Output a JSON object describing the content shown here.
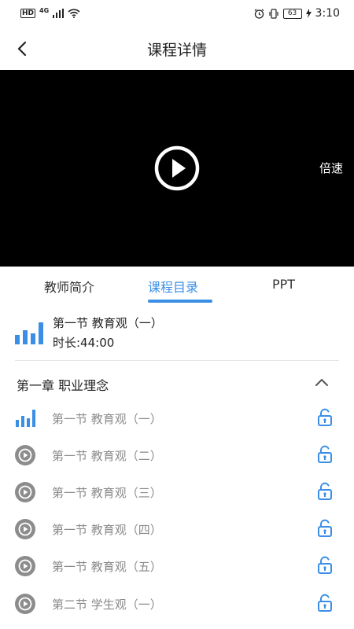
{
  "status_bar": {
    "hd": "HD",
    "network": "4G",
    "battery": "63",
    "time": "3:10"
  },
  "header": {
    "title": "课程详情",
    "back_icon": "chevron-left-icon"
  },
  "video": {
    "play_icon": "play-circle-icon",
    "speed_label": "倍速",
    "background": "#000000"
  },
  "tabs": [
    {
      "label": "教师简介",
      "active": false
    },
    {
      "label": "课程目录",
      "active": true
    },
    {
      "label": "PPT",
      "active": false
    }
  ],
  "now_playing": {
    "icon": "audio-bars-icon",
    "title": "第一节 教育观（一）",
    "duration": "时长:44:00"
  },
  "chapter": {
    "title": "第一章 职业理念",
    "expanded": true,
    "toggle_icon": "chevron-up-icon"
  },
  "lessons": [
    {
      "label": "第一节 教育观（一）",
      "icon": "audio-bars-icon",
      "playing": true,
      "lock_icon": "unlock-icon"
    },
    {
      "label": "第一节 教育观（二）",
      "icon": "play-circle-icon",
      "playing": false,
      "lock_icon": "unlock-icon"
    },
    {
      "label": "第一节 教育观（三）",
      "icon": "play-circle-icon",
      "playing": false,
      "lock_icon": "unlock-icon"
    },
    {
      "label": "第一节 教育观（四）",
      "icon": "play-circle-icon",
      "playing": false,
      "lock_icon": "unlock-icon"
    },
    {
      "label": "第一节 教育观（五）",
      "icon": "play-circle-icon",
      "playing": false,
      "lock_icon": "unlock-icon"
    },
    {
      "label": "第二节 学生观（一）",
      "icon": "play-circle-icon",
      "playing": false,
      "lock_icon": "unlock-icon"
    }
  ],
  "colors": {
    "accent": "#3a8ee6",
    "muted_text": "#8a8a8a",
    "play_icon_gray": "#8c8c8c"
  }
}
